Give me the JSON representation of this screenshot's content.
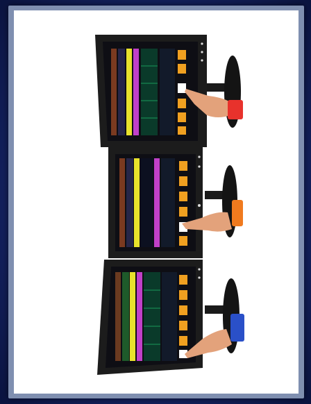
{
  "scene": {
    "background_color": "#1a2a70",
    "frame_color": "#7f8fb0",
    "panel_color": "#ffffff",
    "monitors": [
      {
        "position": "top",
        "hand_sleeve_color": "#e8322c"
      },
      {
        "position": "middle",
        "hand_sleeve_color": "#f07a1e"
      },
      {
        "position": "bottom",
        "hand_sleeve_color": "#2a50c8"
      }
    ],
    "screen_accent_colors": [
      "#e8e22c",
      "#c040c8",
      "#1a9a5a",
      "#f0a020"
    ]
  }
}
